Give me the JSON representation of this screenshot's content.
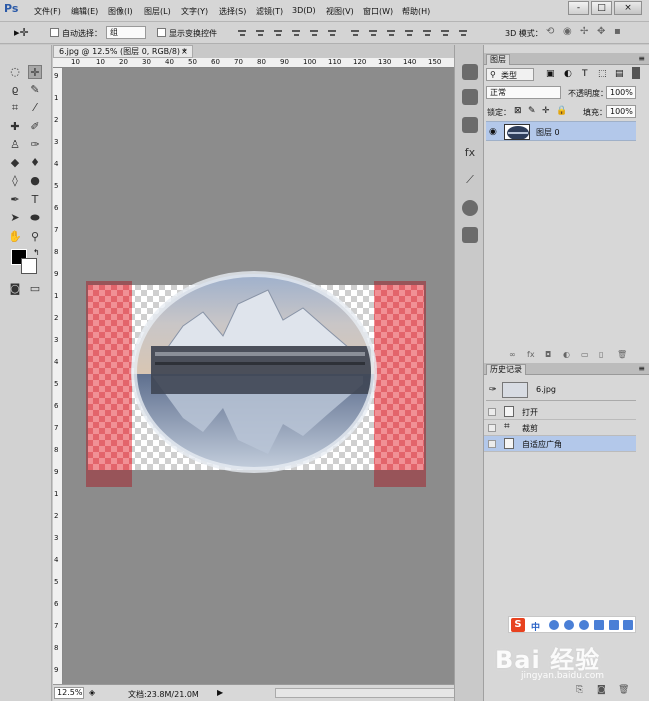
{
  "app": {
    "logo": "Ps"
  },
  "menu": [
    "文件(F)",
    "编辑(E)",
    "图像(I)",
    "图层(L)",
    "文字(Y)",
    "选择(S)",
    "滤镜(T)",
    "3D(D)",
    "视图(V)",
    "窗口(W)",
    "帮助(H)"
  ],
  "window_buttons": {
    "min": "-",
    "restore": "□",
    "close": "×"
  },
  "options": {
    "auto_select_label": "自动选择：",
    "auto_select_value": "组",
    "show_transform_label": "显示变换控件",
    "mode_3d_label": "3D 模式："
  },
  "document": {
    "tab_title": "6.jpg @ 12.5% (图层 0, RGB/8) *",
    "close": "×",
    "zoom": "12.5%",
    "doc_info": "文档:23.8M/21.0M"
  },
  "ruler_top": [
    "10",
    "10",
    "20",
    "30",
    "40",
    "50",
    "60",
    "70",
    "80",
    "90",
    "100",
    "110",
    "120",
    "130",
    "140",
    "150"
  ],
  "ruler_left": [
    "9",
    "1",
    "2",
    "3",
    "4",
    "5",
    "6",
    "7",
    "8",
    "9",
    "1",
    "2",
    "3",
    "4",
    "5",
    "6",
    "7",
    "8",
    "9",
    "1",
    "2",
    "3",
    "4",
    "5",
    "6",
    "7",
    "8",
    "9"
  ],
  "layers_panel": {
    "tab": "图层",
    "filter_kind": "类型",
    "blend_mode": "正常",
    "opacity_label": "不透明度：",
    "opacity_value": "100%",
    "lock_label": "锁定：",
    "fill_label": "填充：",
    "fill_value": "100%",
    "layers": [
      {
        "name": "图层 0",
        "visible": true
      }
    ]
  },
  "history_panel": {
    "tab": "历史记录",
    "snapshot": "6.jpg",
    "items": [
      "打开",
      "裁剪",
      "自适应广角"
    ],
    "selected_index": 2
  },
  "ime": {
    "logo": "S",
    "lang": "中"
  },
  "watermark": {
    "text": "Bai 经验",
    "sub": "jingyan.baidu.com"
  },
  "colors": {
    "workspace": "#8c8c8c",
    "selection": "#b3c8ea",
    "mask_red": "#e8545c"
  }
}
